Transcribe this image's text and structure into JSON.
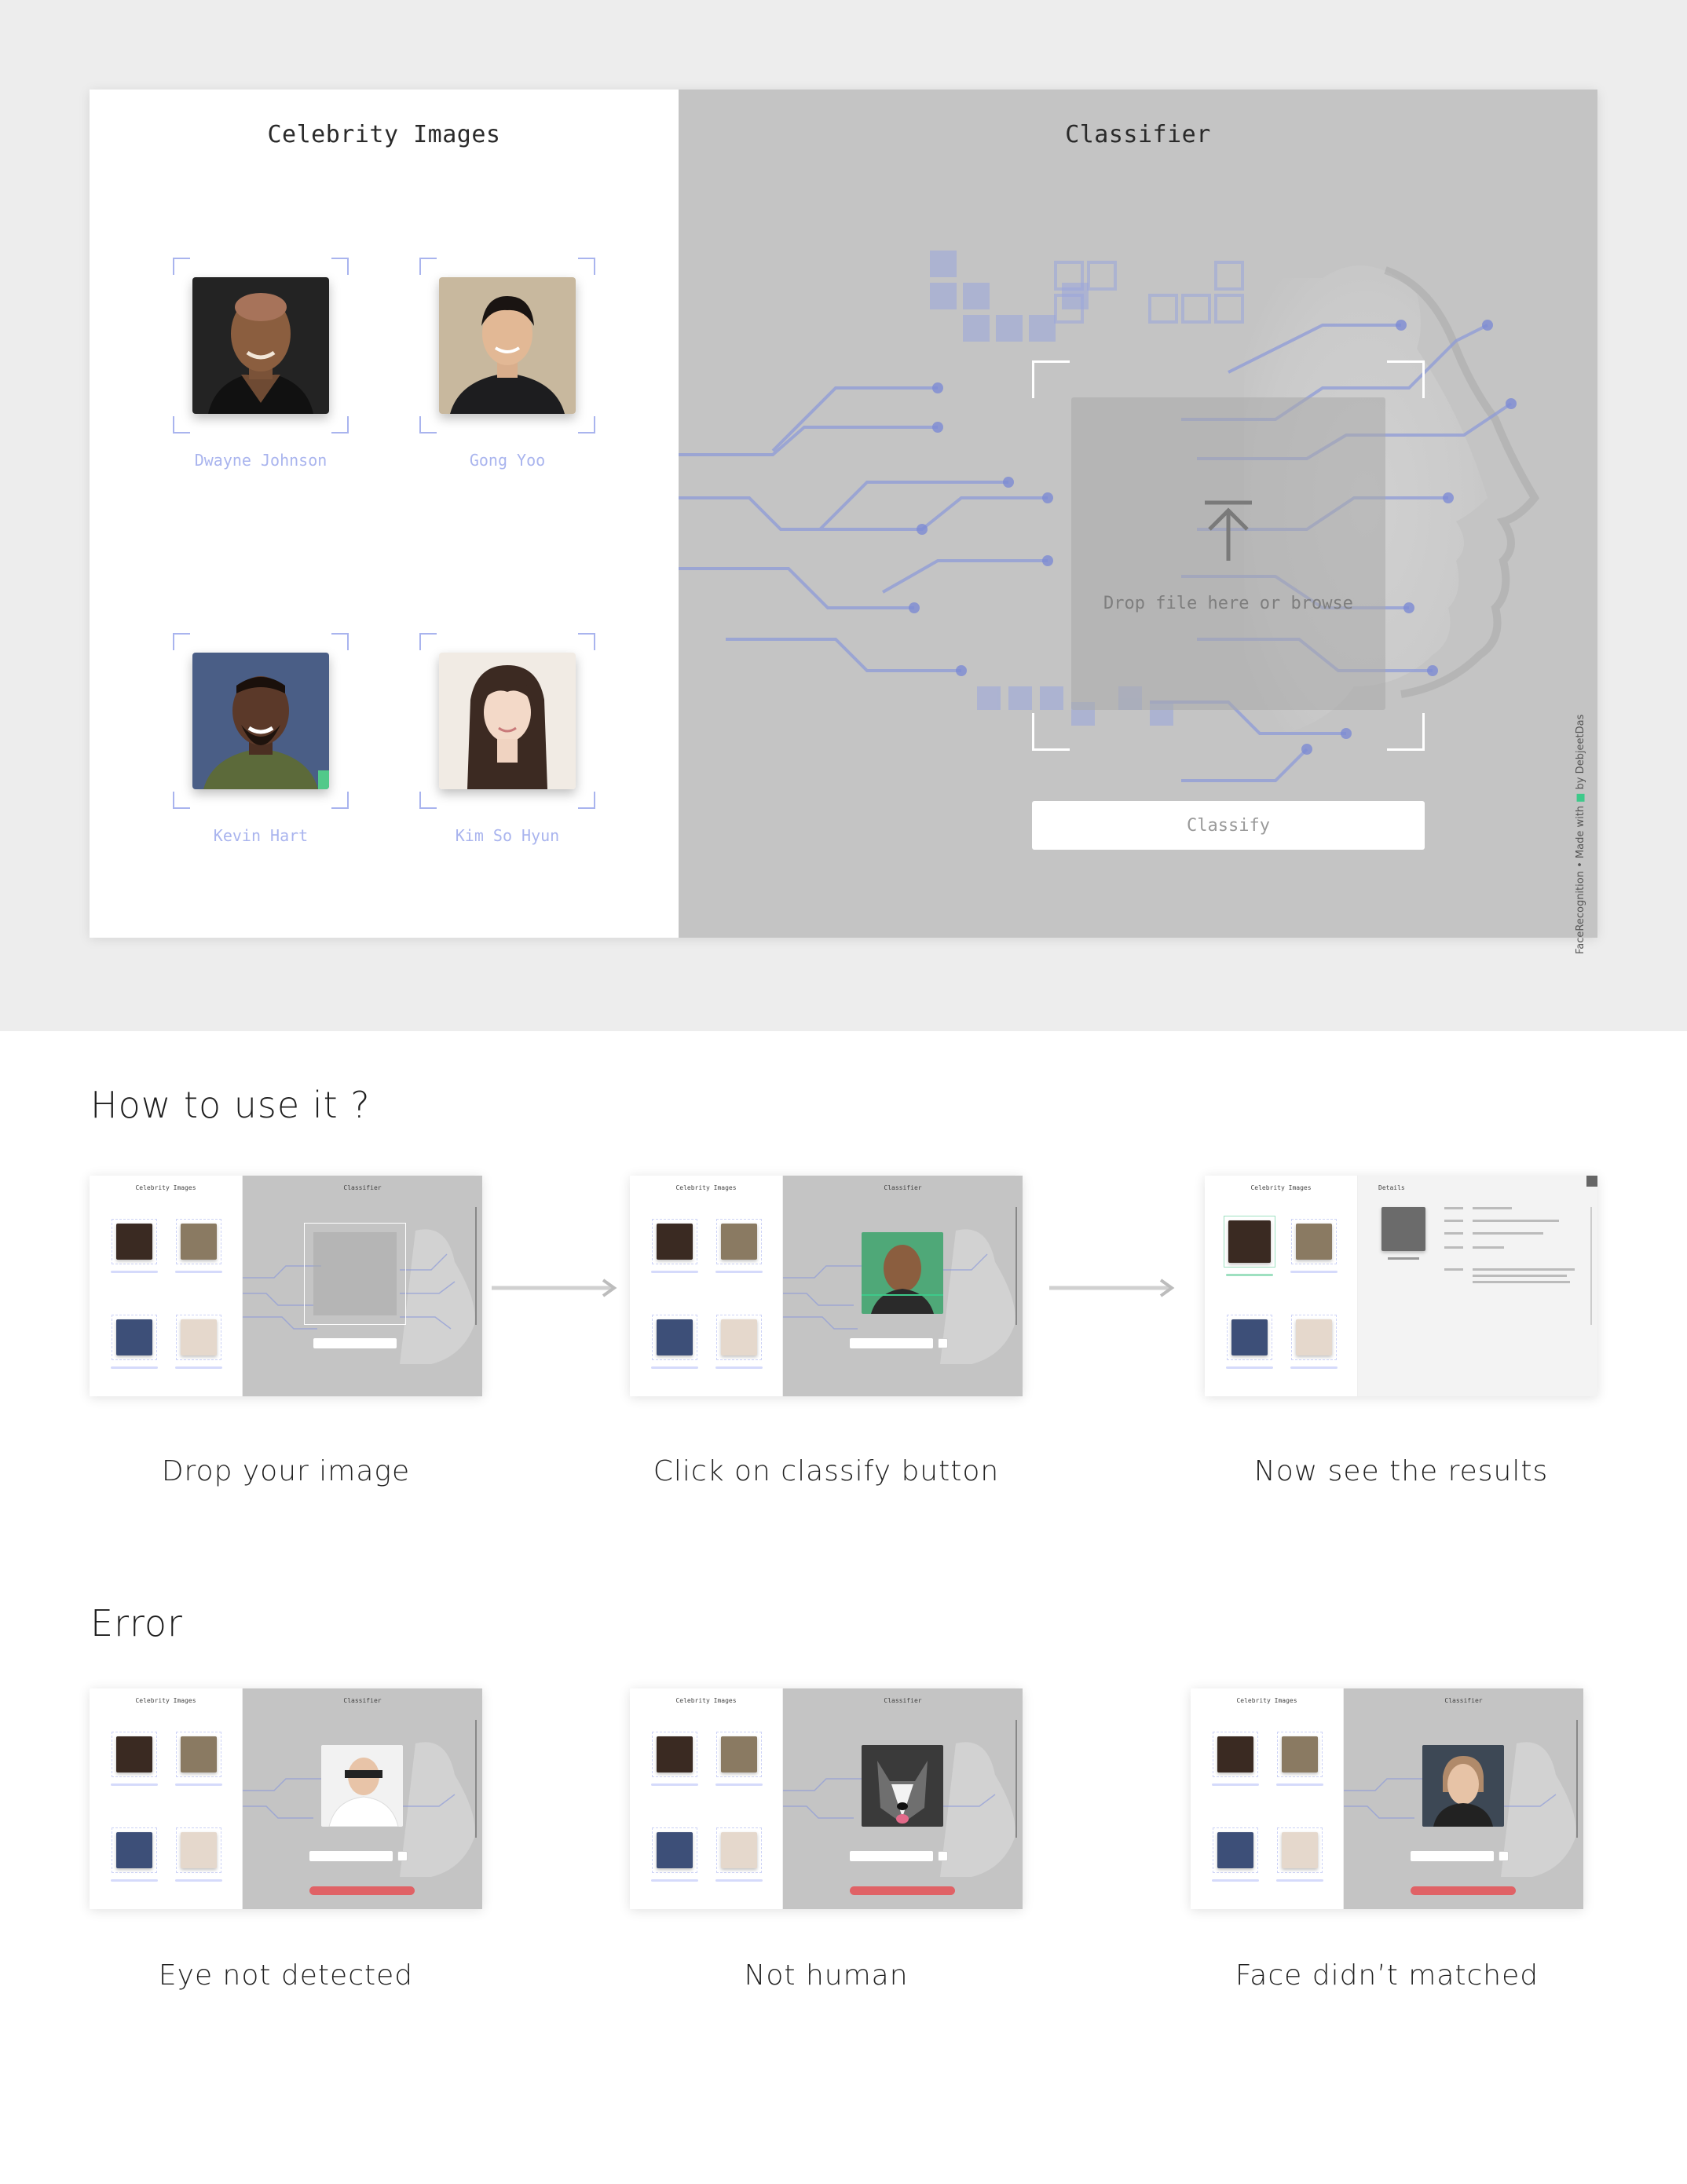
{
  "app": {
    "left_title": "Celebrity Images",
    "right_title": "Classifier",
    "drop_text": "Drop file here or browse",
    "classify_label": "Classify",
    "credit_prefix": "FaceRecognition • Made with",
    "credit_suffix": "by DebjeetDas",
    "celebrities": [
      {
        "name": "Dwayne Johnson"
      },
      {
        "name": "Gong Yoo"
      },
      {
        "name": "Kevin Hart"
      },
      {
        "name": "Kim So Hyun"
      }
    ]
  },
  "how_to": {
    "title": "How to use it ?",
    "steps": [
      {
        "caption": "Drop your image"
      },
      {
        "caption": "Click on classify button"
      },
      {
        "caption": "Now see the results"
      }
    ]
  },
  "errors": {
    "title": "Error",
    "items": [
      {
        "caption": "Eye not detected"
      },
      {
        "caption": "Not human"
      },
      {
        "caption": "Face didn’t matched"
      }
    ]
  },
  "mini": {
    "left_title": "Celebrity Images",
    "right_title": "Classifier",
    "details_title": "Details"
  },
  "colors": {
    "accent": "#a9b4ee",
    "panel_gray": "#c4c4c4",
    "error_red": "#e06266",
    "success_green": "#3ec98a"
  }
}
